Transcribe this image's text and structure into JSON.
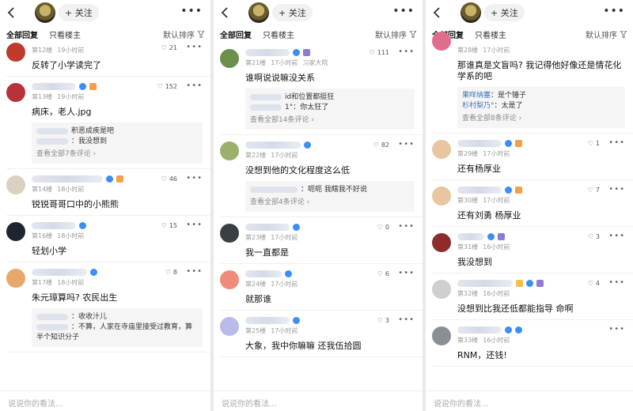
{
  "common": {
    "follow_label": "+ 关注",
    "tab_all": "全部回复",
    "tab_op": "只看楼主",
    "sort_label": "默认排序",
    "input_placeholder": "说说你的看法..."
  },
  "panel1": {
    "comments": [
      {
        "floor": "第12楼",
        "time": "19小时前",
        "likes": "21",
        "text": "反转了小学读完了"
      },
      {
        "floor": "第13楼",
        "time": "19小时前",
        "likes": "152",
        "text": "病床，老人.jpg",
        "replies": [
          "积恶成疾是吧",
          "：我没想到"
        ],
        "more": "查看全部7条评论 ›"
      },
      {
        "floor": "第14楼",
        "time": "18小时前",
        "likes": "46",
        "text": "锐锐哥哥口中的小熊熊"
      },
      {
        "floor": "第16楼",
        "time": "18小时前",
        "likes": "15",
        "text": "轻划小学"
      },
      {
        "floor": "第17楼",
        "time": "18小时前",
        "likes": "8",
        "text": "朱元璋算吗? 农民出生",
        "replies": [
          "：收收汁儿",
          "：不算，人家在寺庙里接受过教育，算半个知识分子"
        ]
      }
    ]
  },
  "panel2": {
    "comments": [
      {
        "floor": "第21楼",
        "time": "17小时前",
        "extra": "习家大院",
        "likes": "111",
        "text": "谁啊说说嘛没关系",
        "replies": [
          "id和位置都挺狂",
          "1°：你太狂了"
        ],
        "more": "查看全部14条评论 ›"
      },
      {
        "floor": "第22楼",
        "time": "17小时前",
        "likes": "82",
        "text": "没想到他的文化程度这么低",
        "replies": [
          "：呃呃 我瞎我不好说"
        ],
        "more": "查看全部4条评论 ›"
      },
      {
        "floor": "第23楼",
        "time": "17小时前",
        "likes": "0",
        "text": "我一直都是"
      },
      {
        "floor": "第24楼",
        "time": "17小时前",
        "likes": "6",
        "text": "就那谁"
      },
      {
        "floor": "第25楼",
        "time": "17小时前",
        "likes": "3",
        "text": "大象，我中你嘛嘛 还我伍拾圆"
      }
    ]
  },
  "panel3": {
    "first": {
      "floor": "第28楼",
      "time": "17小时前",
      "text": "那谁真是文盲吗? 我记得他好像还是情花化学系的吧",
      "replies": [
        {
          "name": "果咩纳塞",
          "text": "：是个锤子"
        },
        {
          "name": "杉村梨乃°",
          "text": "：太是了"
        }
      ],
      "more": "查看全部8条评论 ›"
    },
    "comments": [
      {
        "floor": "第29楼",
        "time": "17小时前",
        "likes": "1",
        "text": "还有杨厚业"
      },
      {
        "floor": "第30楼",
        "time": "17小时前",
        "likes": "7",
        "text": "还有刘勇 杨厚业"
      },
      {
        "floor": "第31楼",
        "time": "16小时前",
        "likes": "3",
        "text": "我没想到"
      },
      {
        "floor": "第32楼",
        "time": "16小时前",
        "likes": "4",
        "text": "没想到比我还低都能指导 命啊"
      },
      {
        "floor": "第33楼",
        "time": "16小时前",
        "likes": "",
        "text": "RNM，还钱!"
      }
    ]
  },
  "colors": {
    "verified": "#3a8ef6",
    "link": "#3a6fb8",
    "meta": "#9a9a9a"
  }
}
